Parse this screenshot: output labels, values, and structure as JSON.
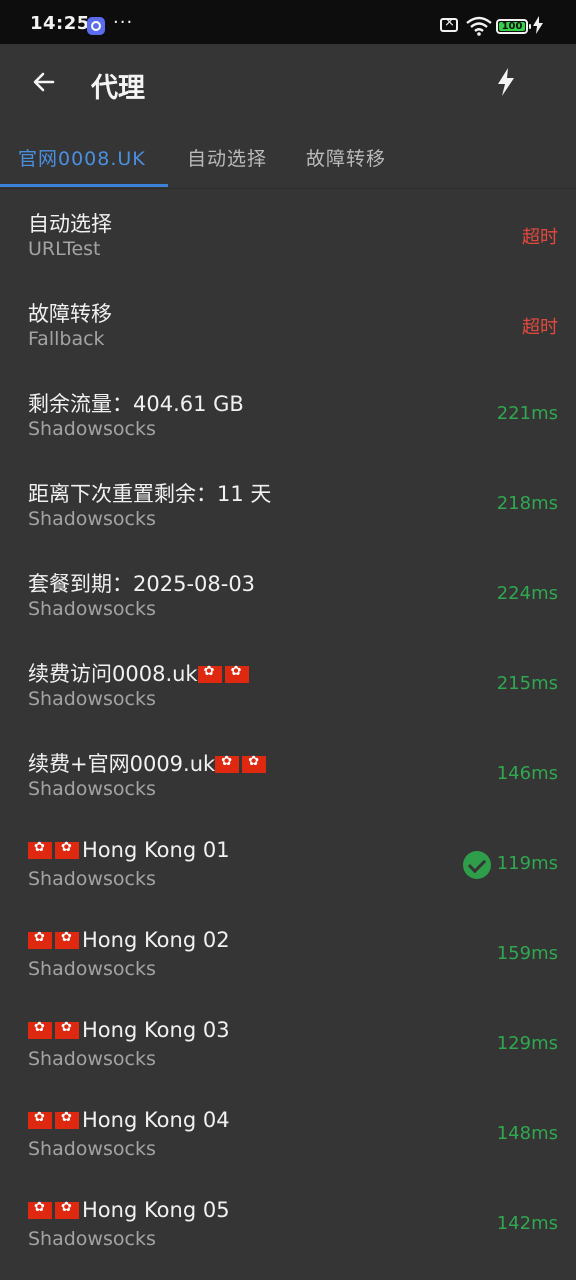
{
  "status_bar": {
    "time": "14:25",
    "more": "···",
    "battery": "100"
  },
  "appbar": {
    "title": "代理",
    "back_icon": "arrow-left-icon",
    "action_icon": "lightning-bolt-icon"
  },
  "tabs": [
    {
      "label": "官网0008.UK",
      "active": true
    },
    {
      "label": "自动选择",
      "active": false
    },
    {
      "label": "故障转移",
      "active": false
    }
  ],
  "proxies": [
    {
      "name": "自动选择",
      "type": "URLTest",
      "delay": "超时",
      "status": "timeout"
    },
    {
      "name": "故障转移",
      "type": "Fallback",
      "delay": "超时",
      "status": "timeout"
    },
    {
      "name": "剩余流量：404.61 GB",
      "type": "Shadowsocks",
      "delay": "221ms"
    },
    {
      "name": "距离下次重置剩余：11 天",
      "type": "Shadowsocks",
      "delay": "218ms"
    },
    {
      "name": "套餐到期：2025-08-03",
      "type": "Shadowsocks",
      "delay": "224ms"
    },
    {
      "name": "续费访问0008.uk",
      "type": "Shadowsocks",
      "delay": "215ms",
      "flag_suffix": true
    },
    {
      "name": "续费+官网0009.uk",
      "type": "Shadowsocks",
      "delay": "146ms",
      "flag_suffix": true
    },
    {
      "name": "Hong Kong 01",
      "type": "Shadowsocks",
      "delay": "119ms",
      "flag_prefix": true,
      "selected": true
    },
    {
      "name": "Hong Kong 02",
      "type": "Shadowsocks",
      "delay": "159ms",
      "flag_prefix": true
    },
    {
      "name": "Hong Kong 03",
      "type": "Shadowsocks",
      "delay": "129ms",
      "flag_prefix": true
    },
    {
      "name": "Hong Kong 04",
      "type": "Shadowsocks",
      "delay": "148ms",
      "flag_prefix": true
    },
    {
      "name": "Hong Kong 05",
      "type": "Shadowsocks",
      "delay": "142ms",
      "flag_prefix": true
    }
  ],
  "colors": {
    "background": "#353535",
    "accent": "#3b82d8",
    "delay_ok": "#2fa84f",
    "delay_timeout": "#e5493e"
  }
}
